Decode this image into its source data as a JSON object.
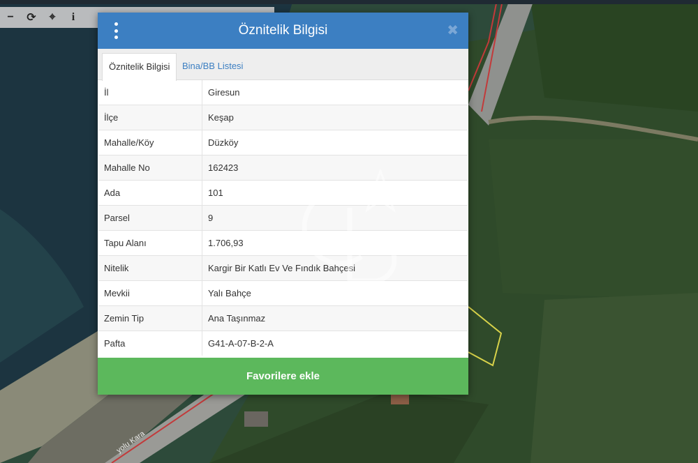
{
  "toolbar": {
    "zoom_out": "−",
    "refresh": "⟳",
    "locate": "⌖",
    "info": "i"
  },
  "dialog": {
    "title": "Öznitelik Bilgisi",
    "close": "✖",
    "tabs": [
      {
        "label": "Öznitelik Bilgisi",
        "active": true
      },
      {
        "label": "Bina/BB Listesi",
        "active": false
      }
    ],
    "rows": [
      {
        "key": "İl",
        "value": "Giresun"
      },
      {
        "key": "İlçe",
        "value": "Keşap"
      },
      {
        "key": "Mahalle/Köy",
        "value": "Düzköy"
      },
      {
        "key": "Mahalle No",
        "value": "162423"
      },
      {
        "key": "Ada",
        "value": "101"
      },
      {
        "key": "Parsel",
        "value": "9"
      },
      {
        "key": "Tapu Alanı",
        "value": "1.706,93"
      },
      {
        "key": "Nitelik",
        "value": "Kargir Bir Katlı Ev Ve Fındık Bahçesi"
      },
      {
        "key": "Mevkii",
        "value": "Yalı Bahçe"
      },
      {
        "key": "Zemin Tip",
        "value": "Ana Taşınmaz"
      },
      {
        "key": "Pafta",
        "value": "G41-A-07-B-2-A"
      }
    ],
    "favorite_button": "Favorilere ekle"
  },
  "map": {
    "road_label": "yolu Kara"
  },
  "watermark": {
    "letters": "CB",
    "mark": "SM"
  },
  "colors": {
    "header": "#3c7fc2",
    "favorite": "#5cb85c",
    "parcel_outline": "#d8d24a"
  }
}
